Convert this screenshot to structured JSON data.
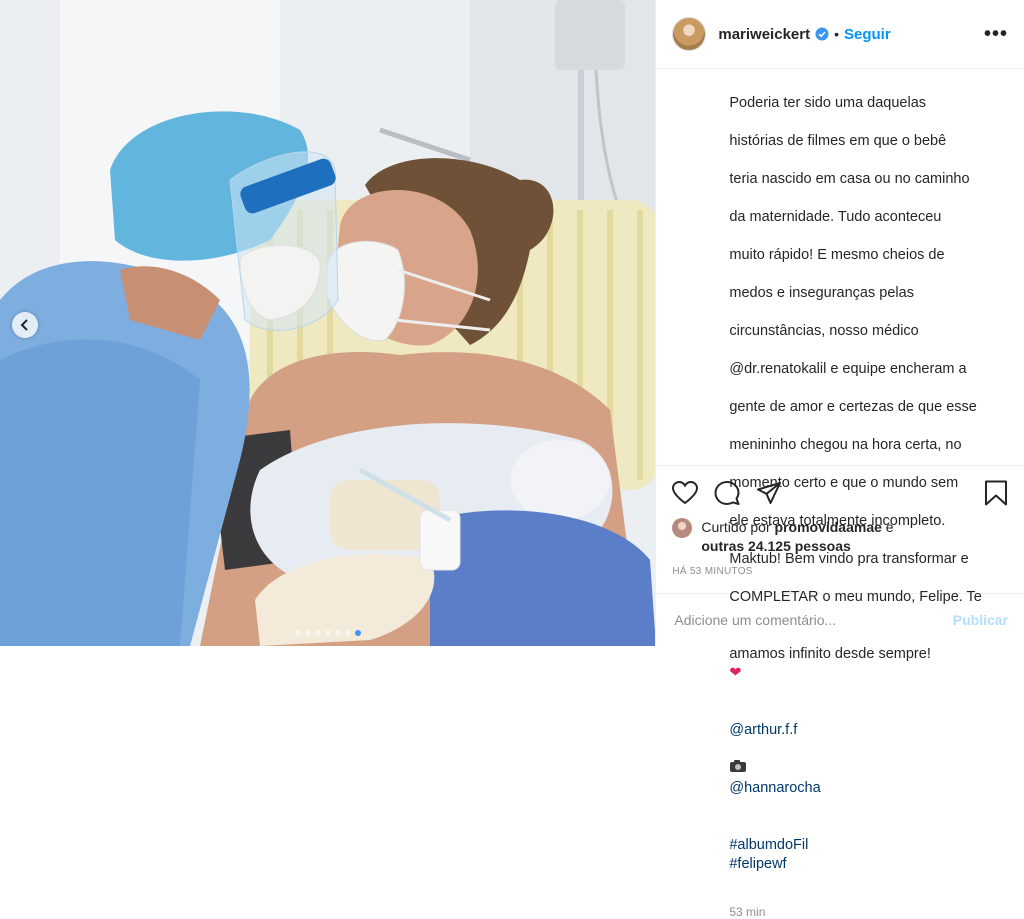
{
  "post": {
    "username": "mariweickert",
    "separator": "•",
    "follow_label": "Seguir",
    "more_label": "•••",
    "caption_lines": [
      "Poderia ter sido uma daquelas",
      "histórias de filmes em que o bebê",
      "teria nascido em casa ou no caminho",
      "da maternidade. Tudo aconteceu",
      "muito rápido! E mesmo cheios de",
      "medos e inseguranças pelas",
      "circunstâncias, nosso médico",
      "@dr.renatokalil e equipe encheram a",
      "gente de amor e certezas de que esse",
      "menininho chegou na hora certa, no",
      "momento certo e que o mundo sem",
      "ele estava totalmente incompleto.",
      "Maktub! Bem vindo pra transformar e",
      "COMPLETAR o meu mundo, Felipe. Te",
      "amamos infinito desde sempre!"
    ],
    "heart_emoji": "❤",
    "credit_1": "@arthur.f.f",
    "credit_2": "@hannarocha",
    "hashtag_1": "#albumdoFil",
    "hashtag_2": "#felipewf",
    "time_ago": "53 min",
    "likes_prefix": "Curtido por",
    "likes_user": "promovidaamae",
    "likes_conjunction": "e",
    "likes_others": "outras 24.125 pessoas",
    "posted_when": "HÁ 53 MINUTOS",
    "comment_placeholder": "Adicione um comentário...",
    "publish_label": "Publicar"
  },
  "carousel": {
    "total_slides": 7,
    "active_slide": 7
  },
  "icons": [
    "verified-badge-icon",
    "heart-icon",
    "comment-icon",
    "share-icon",
    "bookmark-icon",
    "camera-emoji-icon",
    "chevron-left-icon"
  ],
  "colors": {
    "link": "#0095f6",
    "tag": "#00376b",
    "muted": "#8e8e8e",
    "publish_disabled": "#b2dffc",
    "dot_active": "#3897f0"
  }
}
